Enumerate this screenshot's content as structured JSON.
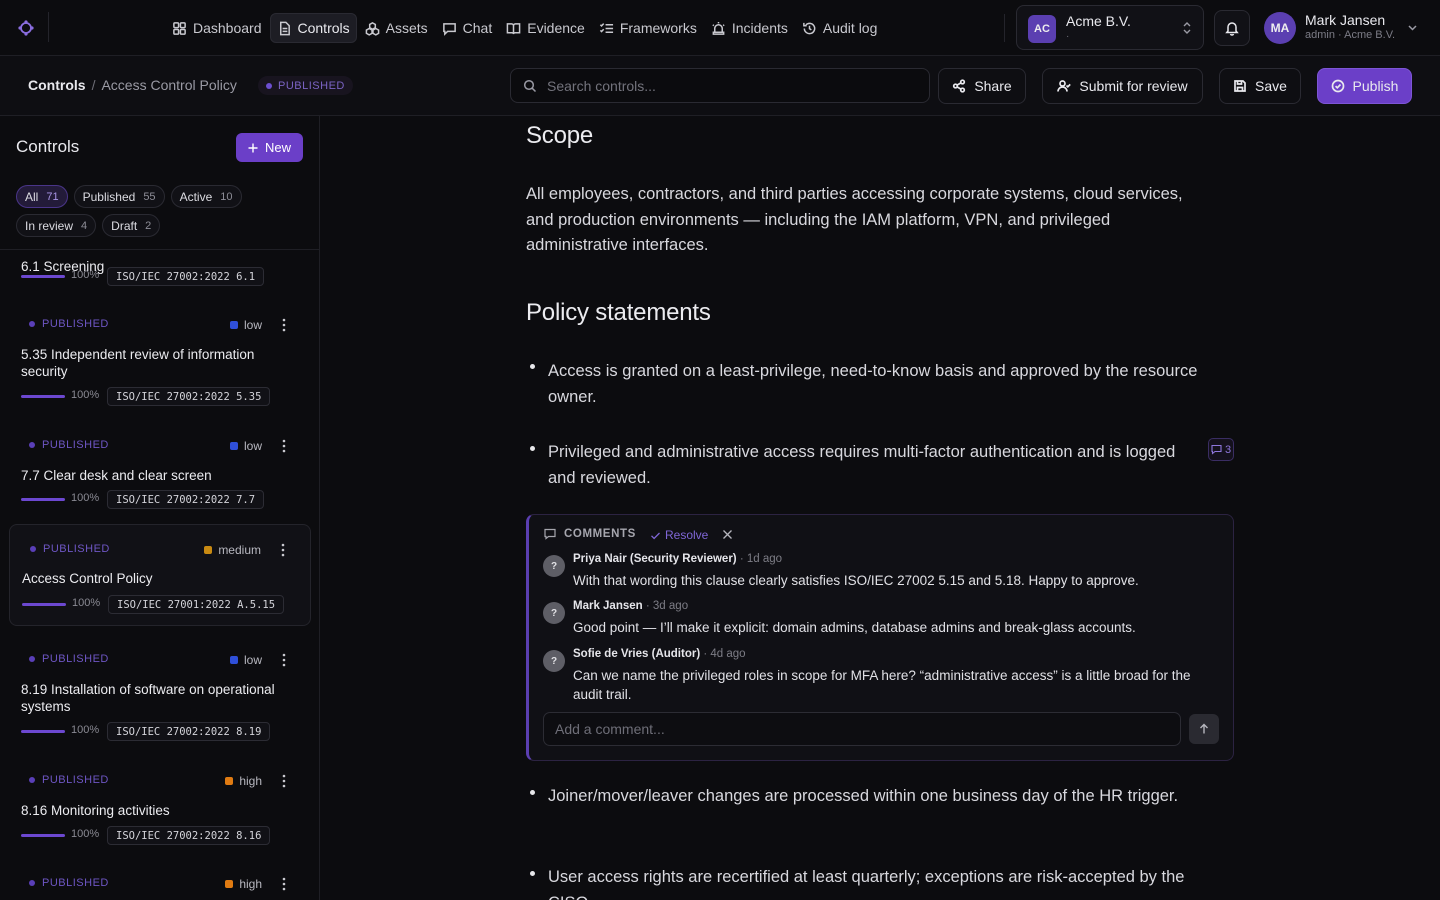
{
  "nav": {
    "items": [
      {
        "label": "Dashboard",
        "icon": "dashboard-icon",
        "active": false
      },
      {
        "label": "Controls",
        "icon": "document-icon",
        "active": true
      },
      {
        "label": "Assets",
        "icon": "boxes-icon",
        "active": false
      },
      {
        "label": "Chat",
        "icon": "chat-icon",
        "active": false
      },
      {
        "label": "Evidence",
        "icon": "book-icon",
        "active": false
      },
      {
        "label": "Frameworks",
        "icon": "list-check-icon",
        "active": false
      },
      {
        "label": "Incidents",
        "icon": "siren-icon",
        "active": false
      },
      {
        "label": "Audit log",
        "icon": "history-icon",
        "active": false
      }
    ]
  },
  "org": {
    "initials": "AC",
    "name": "Acme B.V.",
    "sub": "·"
  },
  "user": {
    "initials": "MA",
    "name": "Mark Jansen",
    "role": "admin · Acme B.V."
  },
  "breadcrumb": {
    "root": "Controls",
    "separator": "/",
    "current": "Access Control Policy"
  },
  "doc_status": "PUBLISHED",
  "search": {
    "placeholder": "Search controls..."
  },
  "actions": {
    "share": "Share",
    "submit": "Submit for review",
    "save": "Save",
    "publish": "Publish"
  },
  "sidebar": {
    "title": "Controls",
    "new_label": "New",
    "filters": [
      {
        "label": "All",
        "count": "71",
        "active": true
      },
      {
        "label": "Published",
        "count": "55",
        "active": false
      },
      {
        "label": "Active",
        "count": "10",
        "active": false
      },
      {
        "label": "In review",
        "count": "4",
        "active": false
      },
      {
        "label": "Draft",
        "count": "2",
        "active": false
      }
    ],
    "partial_item": {
      "title": "6.1 Screening",
      "progress": "100%",
      "ref": "ISO/IEC 27002:2022 6.1"
    },
    "items": [
      {
        "status": "PUBLISHED",
        "severity": "low",
        "title": "5.35 Independent review of information security",
        "progress": "100%",
        "ref": "ISO/IEC 27002:2022 5.35"
      },
      {
        "status": "PUBLISHED",
        "severity": "low",
        "title": "7.7 Clear desk and clear screen",
        "progress": "100%",
        "ref": "ISO/IEC 27002:2022 7.7"
      },
      {
        "status": "PUBLISHED",
        "severity": "medium",
        "title": "Access Control Policy",
        "progress": "100%",
        "ref": "ISO/IEC 27001:2022 A.5.15"
      },
      {
        "status": "PUBLISHED",
        "severity": "low",
        "title": "8.19 Installation of software on operational systems",
        "progress": "100%",
        "ref": "ISO/IEC 27002:2022 8.19"
      },
      {
        "status": "PUBLISHED",
        "severity": "high",
        "title": "8.16 Monitoring activities",
        "progress": "100%",
        "ref": "ISO/IEC 27002:2022 8.16"
      },
      {
        "status": "PUBLISHED",
        "severity": "high",
        "title": "",
        "progress": "",
        "ref": ""
      }
    ],
    "severity_colors": {
      "low": "#2f4fd8",
      "medium": "#c98a12",
      "high": "#e07b12"
    }
  },
  "document": {
    "scope_heading": "Scope",
    "scope_text": "All employees, contractors, and third parties accessing corporate systems, cloud services, and production environments — including the IAM platform, VPN, and privileged administrative interfaces.",
    "statements_heading": "Policy statements",
    "statements": [
      "Access is granted on a least-privilege, need-to-know basis and approved by the resource owner.",
      "Privileged and administrative access requires multi-factor authentication and is logged and reviewed.",
      "Joiner/mover/leaver changes are processed within one business day of the HR trigger.",
      "User access rights are recertified at least quarterly; exceptions are risk-accepted by the CISO."
    ],
    "comment_count": "3"
  },
  "comments": {
    "heading": "COMMENTS",
    "resolve_label": "Resolve",
    "input_placeholder": "Add a comment...",
    "items": [
      {
        "avatar": "?",
        "author": "Priya Nair (Security Reviewer)",
        "time": "· 1d ago",
        "text": "With that wording this clause clearly satisfies ISO/IEC 27002 5.15 and 5.18. Happy to approve."
      },
      {
        "avatar": "?",
        "author": "Mark Jansen",
        "time": "· 3d ago",
        "text": "Good point — I’ll make it explicit: domain admins, database admins and break-glass accounts."
      },
      {
        "avatar": "?",
        "author": "Sofie de Vries (Auditor)",
        "time": "· 4d ago",
        "text": "Can we name the privileged roles in scope for MFA here? “administrative access” is a little broad for the audit trail."
      }
    ]
  }
}
